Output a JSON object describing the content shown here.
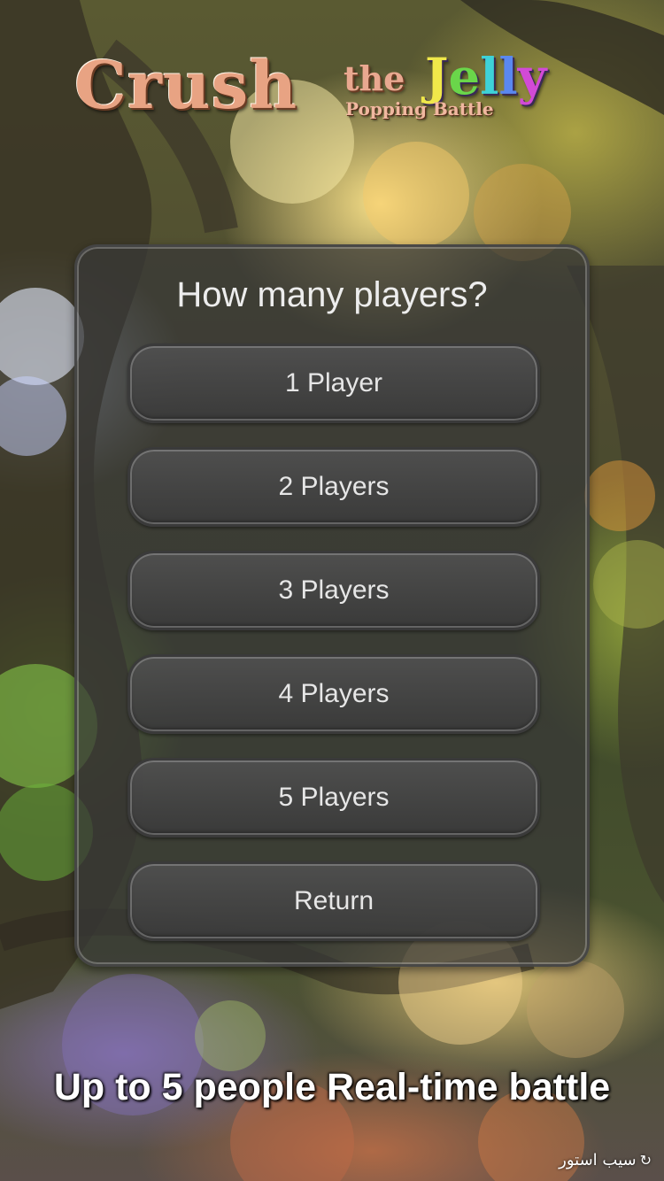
{
  "logo": {
    "crush": "Crush",
    "the": "the",
    "jelly": "Jelly",
    "subtitle": "Popping Battle"
  },
  "dialog": {
    "title": "How many players?",
    "buttons": [
      "1 Player",
      "2 Players",
      "3 Players",
      "4 Players",
      "5 Players",
      "Return"
    ]
  },
  "tagline": "Up to 5 people Real-time battle",
  "watermark": {
    "text": "سیب استور",
    "icon": "store-logo-icon"
  },
  "colors": {
    "panel": "#373737",
    "button_text": "#e6e6e6",
    "title_text": "#ededed",
    "logo_crush": "#e8a383"
  }
}
